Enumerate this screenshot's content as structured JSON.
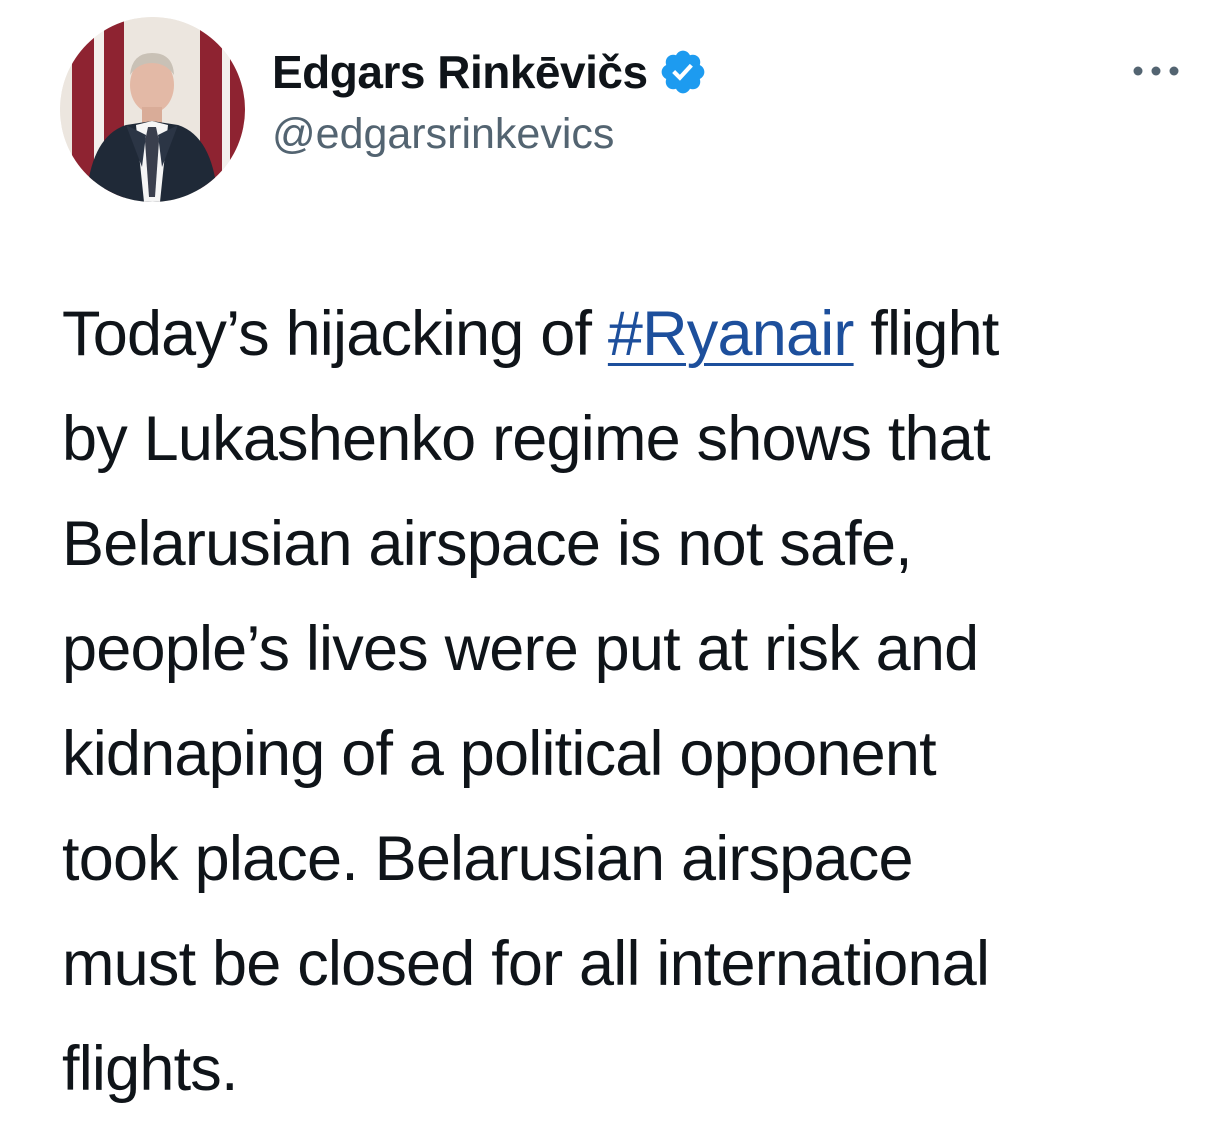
{
  "author": {
    "display_name": "Edgars Rinkēvičs",
    "handle": "@edgarsrinkevics",
    "verified_icon": "verified-badge-icon",
    "avatar_icon": "profile-photo"
  },
  "menu": {
    "icon": "more-options-icon"
  },
  "tweet": {
    "line_1_before": "Today’s hijacking of ",
    "hashtag": "#Ryanair",
    "line_1_after": " flight",
    "line_2": "by Lukashenko regime shows that",
    "line_3": "Belarusian airspace is not safe,",
    "line_4": "people’s lives were put at risk and",
    "line_5": "kidnaping of a political opponent",
    "line_6": "took place. Belarusian airspace",
    "line_7": "must be closed for all international",
    "line_8": "flights."
  },
  "colors": {
    "text": "#0f1419",
    "secondary": "#536471",
    "link": "#1d4f9c",
    "verified": "#1d9bf0"
  }
}
